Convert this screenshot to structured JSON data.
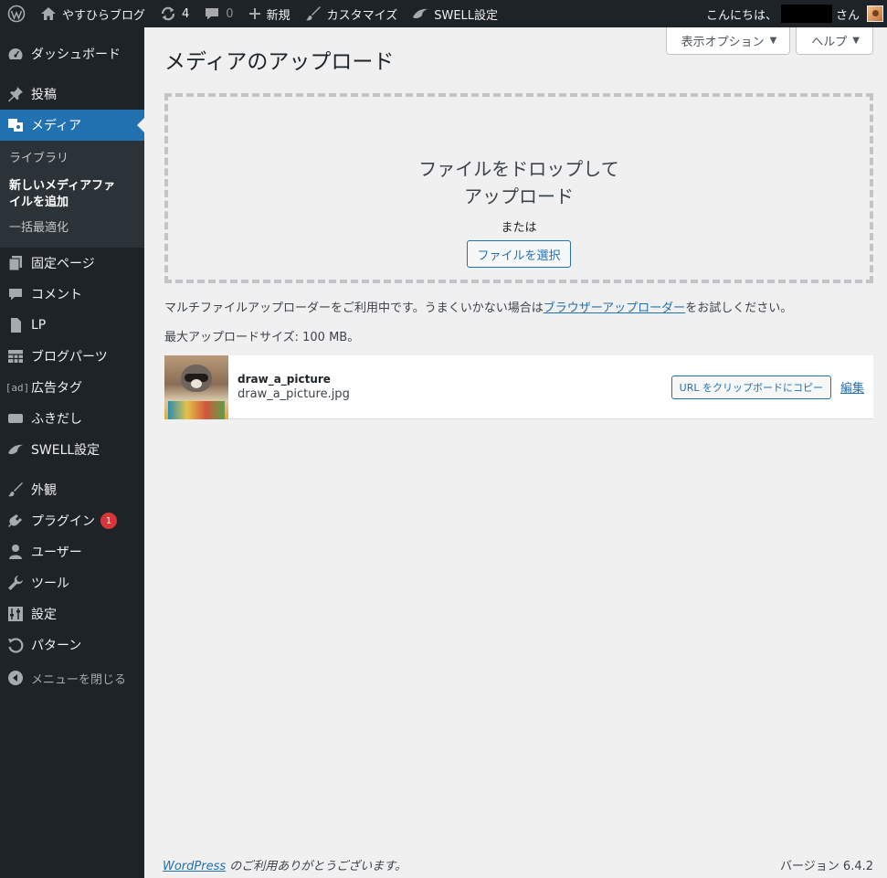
{
  "adminbar": {
    "site_name": "やすひらブログ",
    "updates_count": "4",
    "comments_count": "0",
    "new_label": "新規",
    "customize_label": "カスタマイズ",
    "swell_label": "SWELL設定",
    "greeting_prefix": "こんにちは、",
    "greeting_suffix": "さん"
  },
  "sidebar": {
    "dashboard": "ダッシュボード",
    "posts": "投稿",
    "media": "メディア",
    "media_sub": {
      "library": "ライブラリ",
      "add_new": "新しいメディアファイルを追加",
      "bulk_optimize": "一括最適化"
    },
    "pages": "固定ページ",
    "comments": "コメント",
    "lp": "LP",
    "blog_parts": "ブログパーツ",
    "ad_tag": "広告タグ",
    "fukidashi": "ふきだし",
    "swell_settings": "SWELL設定",
    "appearance": "外観",
    "plugins": "プラグイン",
    "plugins_badge": "1",
    "users": "ユーザー",
    "tools": "ツール",
    "settings": "設定",
    "patterns": "パターン",
    "collapse": "メニューを閉じる"
  },
  "main": {
    "screen_options": "表示オプション",
    "help": "ヘルプ",
    "title": "メディアのアップロード",
    "drop_line1": "ファイルをドロップして",
    "drop_line2": "アップロード",
    "or": "または",
    "select_files": "ファイルを選択",
    "info_before": "マルチファイルアップローダーをご利用中です。うまくいかない場合は",
    "info_link": "ブラウザーアップローダー",
    "info_after": "をお試しください。",
    "max_size": "最大アップロードサイズ: 100 MB。",
    "item": {
      "title": "draw_a_picture",
      "filename": "draw_a_picture.jpg",
      "copy_url": "URL をクリップボードにコピー",
      "edit": "編集"
    }
  },
  "footer": {
    "wp_link": "WordPress",
    "thanks": " のご利用ありがとうございます。",
    "version": "バージョン 6.4.2"
  },
  "colors": {
    "adminbar_bg": "#1d2327",
    "accent": "#2271b1",
    "badge": "#d63638"
  }
}
